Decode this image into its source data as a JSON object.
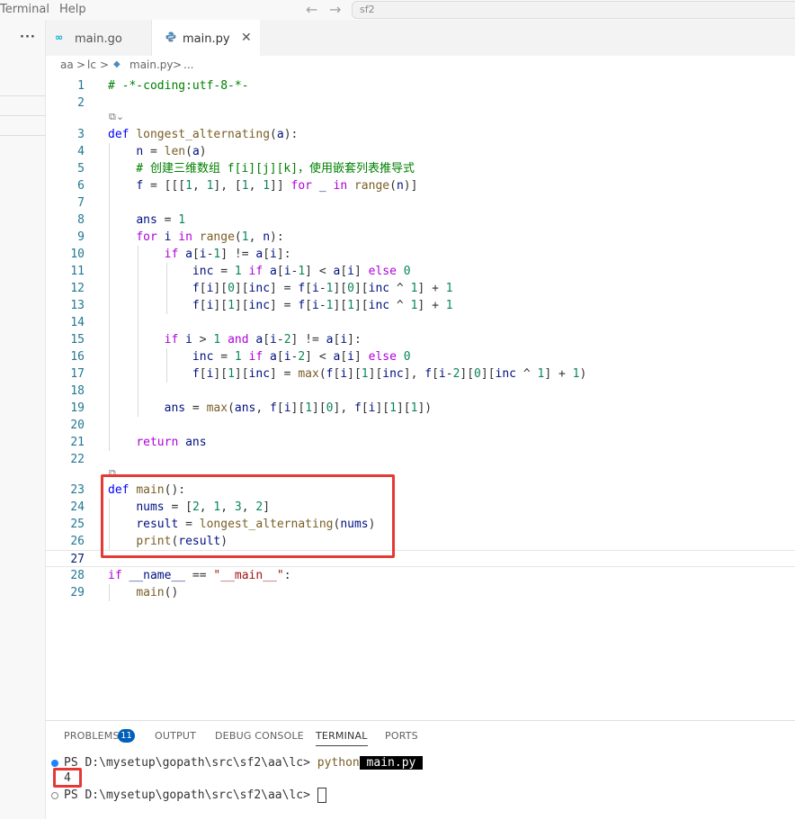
{
  "menubar": {
    "terminal": "Terminal",
    "help": "Help",
    "back": "←",
    "forward": "→",
    "search_text": "sf2"
  },
  "sidebar": {
    "more": "···"
  },
  "tabs": [
    {
      "label": "main.go",
      "icon": "go-file-icon",
      "active": false
    },
    {
      "label": "main.py",
      "icon": "python-file-icon",
      "active": true,
      "close": "✕"
    }
  ],
  "breadcrumb": {
    "seg1": "aa",
    "seg2": "lc",
    "seg3": "main.py",
    "sep": ">",
    "more": "..."
  },
  "editor": {
    "lines": [
      {
        "n": "1",
        "code": "# -*-coding:utf-8-*-"
      },
      {
        "n": "2",
        "code": ""
      },
      {
        "n": "3",
        "code": "def longest_alternating(a):"
      },
      {
        "n": "4",
        "code": "    n = len(a)"
      },
      {
        "n": "5",
        "code": "    # 创建三维数组 f[i][j][k]，使用嵌套列表推导式"
      },
      {
        "n": "6",
        "code": "    f = [[[1, 1], [1, 1]] for _ in range(n)]"
      },
      {
        "n": "7",
        "code": ""
      },
      {
        "n": "8",
        "code": "    ans = 1"
      },
      {
        "n": "9",
        "code": "    for i in range(1, n):"
      },
      {
        "n": "10",
        "code": "        if a[i-1] != a[i]:"
      },
      {
        "n": "11",
        "code": "            inc = 1 if a[i-1] < a[i] else 0"
      },
      {
        "n": "12",
        "code": "            f[i][0][inc] = f[i-1][0][inc ^ 1] + 1"
      },
      {
        "n": "13",
        "code": "            f[i][1][inc] = f[i-1][1][inc ^ 1] + 1"
      },
      {
        "n": "14",
        "code": ""
      },
      {
        "n": "15",
        "code": "        if i > 1 and a[i-2] != a[i]:"
      },
      {
        "n": "16",
        "code": "            inc = 1 if a[i-2] < a[i] else 0"
      },
      {
        "n": "17",
        "code": "            f[i][1][inc] = max(f[i][1][inc], f[i-2][0][inc ^ 1] + 1)"
      },
      {
        "n": "18",
        "code": ""
      },
      {
        "n": "19",
        "code": "        ans = max(ans, f[i][1][0], f[i][1][1])"
      },
      {
        "n": "20",
        "code": ""
      },
      {
        "n": "21",
        "code": "    return ans"
      },
      {
        "n": "22",
        "code": ""
      },
      {
        "n": "23",
        "code": "def main():"
      },
      {
        "n": "24",
        "code": "    nums = [2, 1, 3, 2]"
      },
      {
        "n": "25",
        "code": "    result = longest_alternating(nums)"
      },
      {
        "n": "26",
        "code": "    print(result)"
      },
      {
        "n": "27",
        "code": ""
      },
      {
        "n": "28",
        "code": "if __name__ == \"__main__\":"
      },
      {
        "n": "29",
        "code": "    main()"
      }
    ]
  },
  "panel": {
    "tabs": {
      "problems": "PROBLEMS",
      "problems_count": "11",
      "output": "OUTPUT",
      "debug": "DEBUG CONSOLE",
      "terminal": "TERMINAL",
      "ports": "PORTS"
    },
    "terminal": {
      "prompt1": "PS D:\\mysetup\\gopath\\src\\sf2\\aa\\lc> ",
      "cmd": "python",
      "arg": " main.py ",
      "output": "4",
      "prompt2": "PS D:\\mysetup\\gopath\\src\\sf2\\aa\\lc> "
    }
  },
  "colors": {
    "highlight": "#e53935",
    "accent": "#005fb8",
    "keyword": "#0000ff",
    "control": "#af00db",
    "function": "#795e26",
    "number": "#098658",
    "comment": "#008000",
    "string": "#a31515",
    "variable": "#001080",
    "linenumber": "#237893"
  }
}
